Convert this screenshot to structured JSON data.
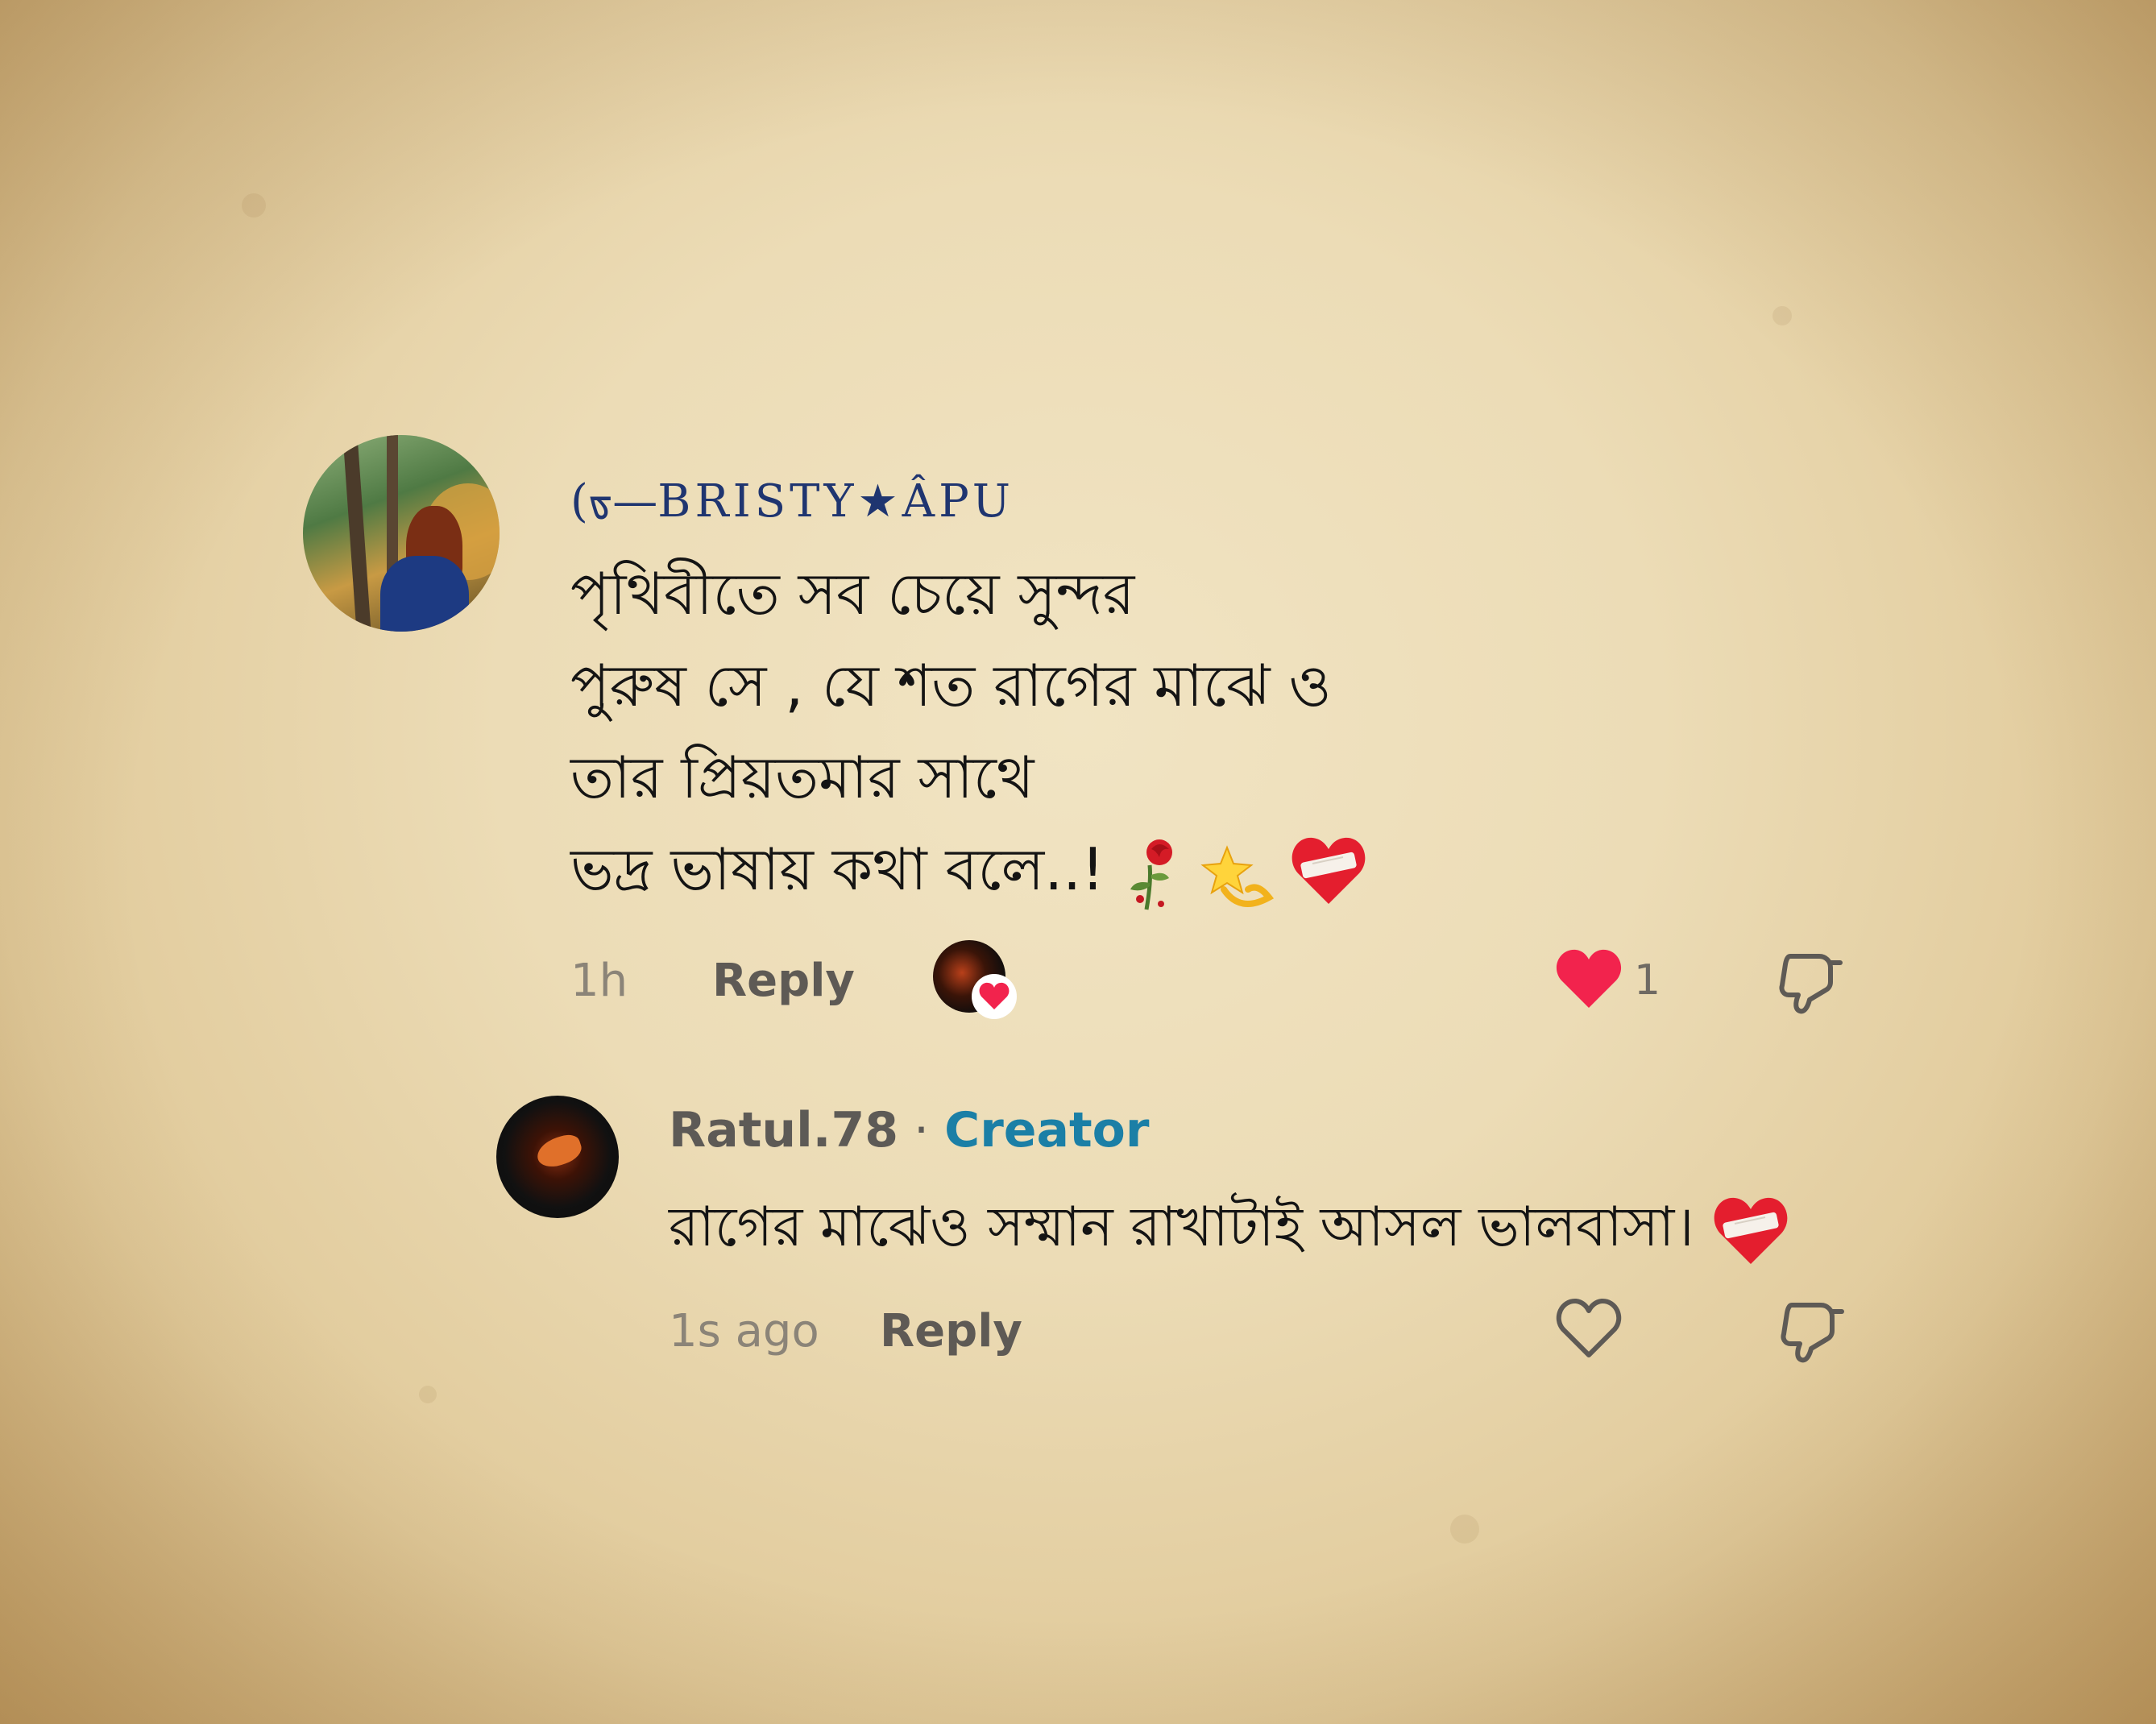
{
  "comment": {
    "username": "(ᢐ—BRISTY★ÂPU",
    "text": "পৃথিবীতে সব চেয়ে সুন্দর\nপুরুষ সে , যে শত রাগের মাঝে ও\nতার প্রিয়তমার সাথে\nভদ্র ভাষায় কথা বলে..!",
    "emojis": [
      "wilted-rose-icon",
      "dizzy-star-icon",
      "mending-heart-icon"
    ],
    "time": "1h",
    "reply_label": "Reply",
    "like_count": "1",
    "liked": true
  },
  "reply": {
    "username": "Ratul.78",
    "separator": " · ",
    "badge": "Creator",
    "text": "রাগের মাঝেও সম্মান রাখাটাই আসল ভালবাসা।",
    "emoji": "mending-heart-icon",
    "time": "1s ago",
    "reply_label": "Reply",
    "liked": false
  },
  "colors": {
    "background": "#ecdcb6",
    "username": "#1f3570",
    "creator_badge": "#1b7fa6",
    "like_heart": "#f2234d",
    "muted_text": "#8b8478"
  }
}
